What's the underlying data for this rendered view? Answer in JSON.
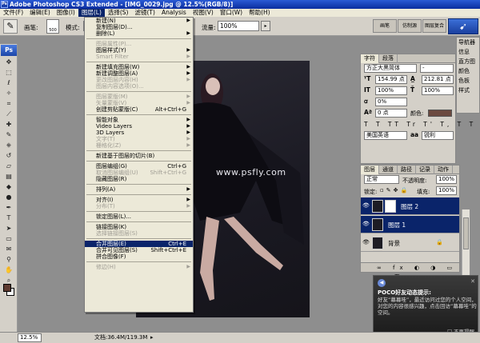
{
  "app": {
    "title": "Adobe Photoshop CS3 Extended - [IMG_0029.jpg @ 12.5%(RGB/8)]",
    "logo": "Ps"
  },
  "menubar": {
    "items": [
      "文件(F)",
      "编辑(E)",
      "图像(I)",
      "图层(L)",
      "选择(S)",
      "滤镜(T)",
      "Analysis",
      "视图(V)",
      "窗口(W)",
      "帮助(H)"
    ],
    "active_index": 3
  },
  "options": {
    "brush_label": "画笔:",
    "brush_size": "500",
    "mode_label": "模式:",
    "flow_label": "流量:",
    "flow_value": "100%",
    "panel_tabs": [
      "画笔",
      "仿制源",
      "图层复合"
    ]
  },
  "layer_menu": {
    "items": [
      {
        "label": "新建(N)",
        "arrow": true
      },
      {
        "label": "复制图层(D)...",
        "disabled": false
      },
      {
        "label": "删除(L)",
        "arrow": true
      },
      {
        "sep": true
      },
      {
        "label": "图层属性(P)...",
        "disabled": true
      },
      {
        "label": "图层样式(Y)",
        "arrow": true
      },
      {
        "label": "Smart Filter",
        "disabled": true,
        "arrow": true
      },
      {
        "sep": true
      },
      {
        "label": "新建填充图层(W)",
        "arrow": true
      },
      {
        "label": "新建调整图层(A)",
        "arrow": true
      },
      {
        "label": "更改图层内容(H)",
        "disabled": true,
        "arrow": true
      },
      {
        "label": "图层内容选项(O)...",
        "disabled": true
      },
      {
        "sep": true
      },
      {
        "label": "图层蒙版(M)",
        "disabled": true,
        "arrow": true
      },
      {
        "label": "矢量蒙版(V)",
        "disabled": true,
        "arrow": true
      },
      {
        "label": "创建剪贴蒙版(C)",
        "shortcut": "Alt+Ctrl+G"
      },
      {
        "sep": true
      },
      {
        "label": "智能对象",
        "arrow": true
      },
      {
        "label": "Video Layers",
        "arrow": true
      },
      {
        "label": "3D Layers",
        "arrow": true
      },
      {
        "label": "文字(T)",
        "disabled": true,
        "arrow": true
      },
      {
        "label": "栅格化(Z)",
        "disabled": true,
        "arrow": true
      },
      {
        "sep": true
      },
      {
        "label": "新建基于图层的切片(B)"
      },
      {
        "sep": true
      },
      {
        "label": "图层编组(G)",
        "shortcut": "Ctrl+G"
      },
      {
        "label": "取消图层编组(U)",
        "shortcut": "Shift+Ctrl+G",
        "disabled": true
      },
      {
        "label": "隐藏图层(R)"
      },
      {
        "sep": true
      },
      {
        "label": "排列(A)",
        "arrow": true
      },
      {
        "sep": true
      },
      {
        "label": "对齐(I)",
        "arrow": true
      },
      {
        "label": "分布(T)",
        "disabled": true,
        "arrow": true
      },
      {
        "sep": true
      },
      {
        "label": "锁定图层(L)..."
      },
      {
        "sep": true
      },
      {
        "label": "链接图层(K)"
      },
      {
        "label": "选择链接图层(S)",
        "disabled": true
      },
      {
        "sep": true
      },
      {
        "label": "合并图层(E)",
        "shortcut": "Ctrl+E",
        "highlight": true
      },
      {
        "label": "合并可见图层(S)",
        "shortcut": "Shift+Ctrl+E"
      },
      {
        "label": "拼合图像(F)"
      },
      {
        "sep": true
      },
      {
        "label": "修边(H)",
        "disabled": true,
        "arrow": true
      }
    ]
  },
  "canvas": {
    "watermark": "www.psfly.com"
  },
  "char_panel": {
    "tabs": [
      "字符",
      "段落"
    ],
    "font_family": "方正大黑简体",
    "font_style": "-",
    "font_size": "154.99 点",
    "leading": "212.81 点",
    "tracking_v": "100%",
    "tracking_h": "100%",
    "kerning": "0%",
    "baseline": "0 点",
    "color_label": "颜色:",
    "language": "美国英语",
    "aa_label": "aa",
    "aa_value": "锐利",
    "type_buttons": "T T TT Tr T' T, T T"
  },
  "side_panel": {
    "items": [
      "导航器",
      "信息",
      "直方图",
      "颜色",
      "色板",
      "样式"
    ]
  },
  "layers_panel": {
    "tabs": [
      "图层",
      "通道",
      "路径",
      "记录",
      "动作"
    ],
    "blend_mode": "正常",
    "opacity_label": "不透明度:",
    "opacity": "100%",
    "lock_label": "锁定:",
    "fill_label": "填充:",
    "fill": "100%",
    "layers": [
      {
        "name": "图层 2",
        "selected": true,
        "mask": true
      },
      {
        "name": "图层 1",
        "selected": true,
        "mask": false
      },
      {
        "name": "背景",
        "selected": false,
        "mask": false,
        "locked": true
      }
    ],
    "footer": "∞ fx ◐ ◑ ▭ ▣ 🗑"
  },
  "tip": {
    "title": "POCO好友动态提示:",
    "body": "好友“幕幕哇”，最近访问过您的个人空间，对您的内容很感兴趣，点击回访“幕幕哇”的空间。",
    "checkbox": "不再提醒"
  },
  "status": {
    "zoom": "12.5%",
    "doc": "文档:36.4M/119.3M"
  }
}
